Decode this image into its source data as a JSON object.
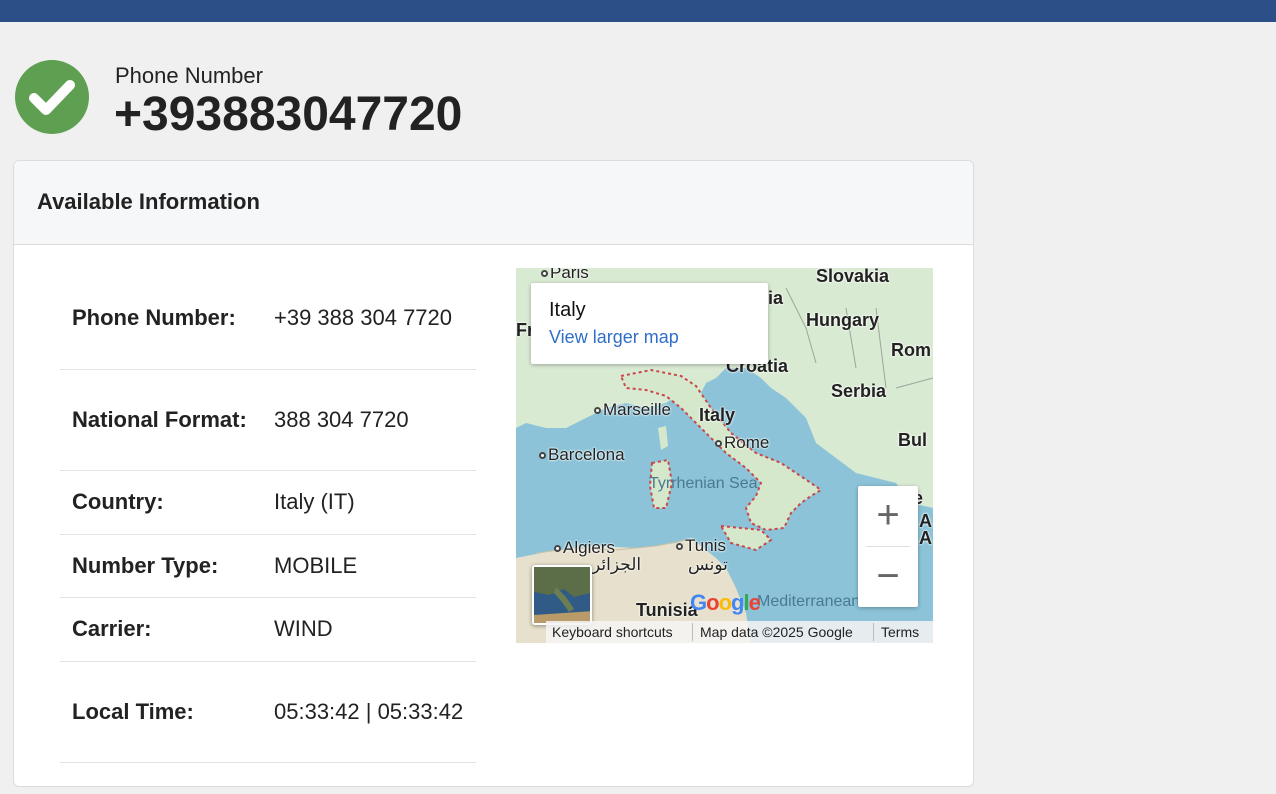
{
  "header": {
    "label": "Phone Number",
    "number": "+393883047720"
  },
  "card": {
    "title": "Available Information",
    "rows": [
      {
        "key": "Phone Number:",
        "value": "+39 388 304 7720"
      },
      {
        "key": "National Format:",
        "value": "388 304 7720"
      },
      {
        "key": "Country:",
        "value": "Italy (IT)"
      },
      {
        "key": "Number Type:",
        "value": "MOBILE"
      },
      {
        "key": "Carrier:",
        "value": "WIND"
      },
      {
        "key": "Local Time:",
        "value": "05:33:42 | 05:33:42"
      }
    ]
  },
  "map": {
    "infobox_title": "Italy",
    "infobox_link": "View larger map",
    "labels": {
      "paris": "Paris",
      "slovakia": "Slovakia",
      "hungary": "Hungary",
      "romania": "Rom",
      "croatia": "Croatia",
      "serbia": "Serbia",
      "bulgaria": "Bul",
      "marseille": "Marseille",
      "italy": "Italy",
      "rome": "Rome",
      "barcelona": "Barcelona",
      "tyrrhenian": "Tyrrhenian Sea",
      "algiers": "Algiers",
      "algiers_ar": "الجزائر",
      "tunis": "Tunis",
      "tunis_ar": "تونس",
      "tunisia": "Tunisia",
      "mediterranean": "Mediterranean Sea",
      "france_partial": "Fr",
      "austria_partial": "ia",
      "greece_partial": "e",
      "albania_partial": "A",
      "albania_partial2": "A"
    },
    "zoom_in": "+",
    "zoom_out": "−",
    "google_logo": "Google",
    "footer": {
      "shortcuts": "Keyboard shortcuts",
      "data": "Map data ©2025 Google",
      "terms": "Terms"
    }
  },
  "colors": {
    "topbar": "#2d4f87",
    "check": "#5f9f52",
    "link": "#2f6fc9",
    "sea": "#8cc3d8",
    "land": "#d9ead3"
  }
}
